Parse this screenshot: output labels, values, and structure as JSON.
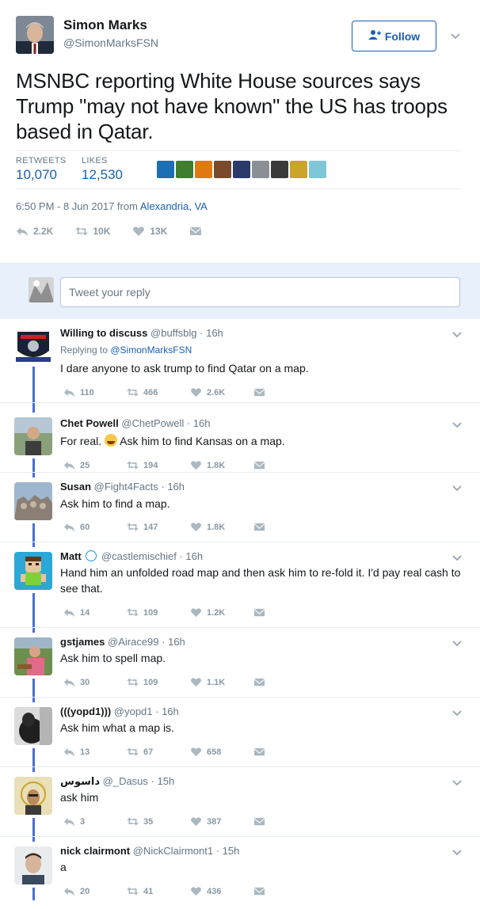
{
  "tweet": {
    "author_name": "Simon Marks",
    "author_handle": "@SimonMarksFSN",
    "follow_label": "Follow",
    "text": "MSNBC reporting White House sources says Trump \"may not have known\" the US has troops based in Qatar.",
    "retweets_label": "RETWEETS",
    "retweets_count": "10,070",
    "likes_label": "LIKES",
    "likes_count": "12,530",
    "timestamp": "6:50 PM - 8 Jun 2017 from ",
    "location": "Alexandria, VA",
    "actions": {
      "replies": "2.2K",
      "retweets": "10K",
      "likes": "13K"
    },
    "liker_colors": [
      "#1b6fb4",
      "#3f7d2f",
      "#e07a10",
      "#7a4b2a",
      "#2b3a6b",
      "#8a8f96",
      "#3a3a3a",
      "#c9a52b",
      "#7fc6d8"
    ]
  },
  "reply_box": {
    "placeholder": "Tweet your reply"
  },
  "replies": [
    {
      "name": "Willing to discuss",
      "handle": "@buffsblg",
      "time": "· 16h",
      "replying_prefix": "Replying to ",
      "replying_to": "@SimonMarksFSN",
      "text": "I dare anyone to ask trump to find Qatar on a map.",
      "reply": "110",
      "retweet": "466",
      "like": "2.6K",
      "avatar_color": "#1a1f3a"
    },
    {
      "name": "Chet Powell",
      "handle": "@ChetPowell",
      "time": "· 16h",
      "text_before": "For real. ",
      "text_after": " Ask him to find Kansas on a map.",
      "reply": "25",
      "retweet": "194",
      "like": "1.8K",
      "avatar_color": "#6f8a5c"
    },
    {
      "name": "Susan",
      "handle": "@Fight4Facts",
      "time": "· 16h",
      "text": "Ask him to find a map.",
      "reply": "60",
      "retweet": "147",
      "like": "1.8K",
      "avatar_color": "#8a9bb0"
    },
    {
      "name": "Matt",
      "handle": "@castlemischief",
      "time": "· 16h",
      "text": "Hand him an unfolded road map and then ask him to re-fold it. I'd pay real cash to see that.",
      "reply": "14",
      "retweet": "109",
      "like": "1.2K",
      "avatar_color": "#2aa8d8"
    },
    {
      "name": "gstjames",
      "handle": "@Airace99",
      "time": "· 16h",
      "text": "Ask him to spell map.",
      "reply": "30",
      "retweet": "109",
      "like": "1.1K",
      "avatar_color": "#6d8f4e"
    },
    {
      "name": "(((yopd1)))",
      "handle": "@yopd1",
      "time": "· 16h",
      "text": "Ask him what a map is.",
      "reply": "13",
      "retweet": "67",
      "like": "658",
      "avatar_color": "#2a2a2a"
    },
    {
      "name": "داسوس",
      "handle": "@_Dasus",
      "time": "· 15h",
      "text": "ask him",
      "reply": "3",
      "retweet": "35",
      "like": "387",
      "avatar_color": "#c9b98a"
    },
    {
      "name": "nick clairmont",
      "handle": "@NickClairmont1",
      "time": "· 15h",
      "text": "a",
      "reply": "20",
      "retweet": "41",
      "like": "436",
      "avatar_color": "#5a5f66"
    }
  ]
}
